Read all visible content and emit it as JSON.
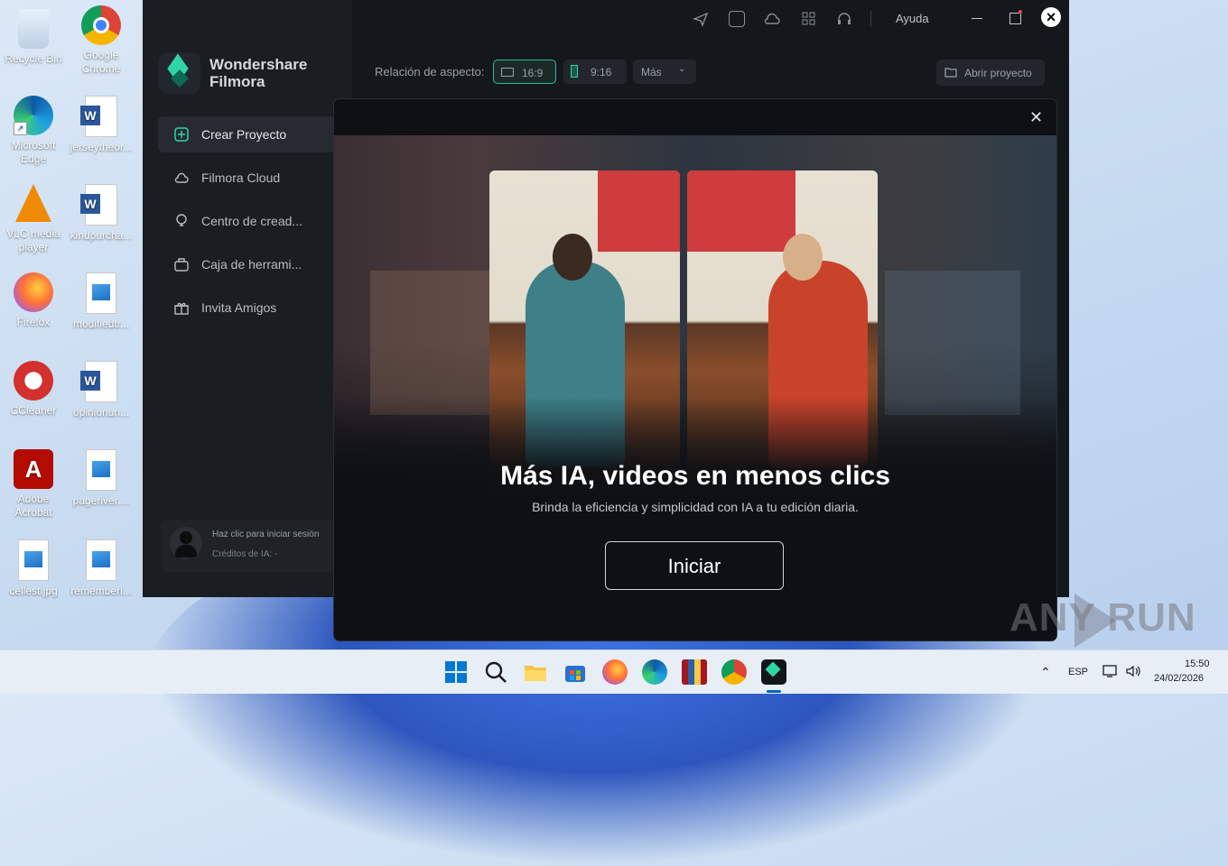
{
  "desktop": {
    "icons": [
      {
        "label": "Recycle Bin"
      },
      {
        "label": "Google Chrome"
      },
      {
        "label": "Microsoft Edge"
      },
      {
        "label": "jerseytheor..."
      },
      {
        "label": "VLC media player"
      },
      {
        "label": "kindpurcha..."
      },
      {
        "label": "Firefox"
      },
      {
        "label": "modifiedtr..."
      },
      {
        "label": "CCleaner"
      },
      {
        "label": "opinionun..."
      },
      {
        "label": "Adobe Acrobat"
      },
      {
        "label": "pageriver...."
      },
      {
        "label": "cellest.jpg"
      },
      {
        "label": "rememberi..."
      }
    ]
  },
  "filmora": {
    "brand_line1": "Wondershare",
    "brand_line2": "Filmora",
    "nav": [
      {
        "label": "Crear Proyecto",
        "icon": "plus-square-icon"
      },
      {
        "label": "Filmora Cloud",
        "icon": "cloud-icon"
      },
      {
        "label": "Centro de cread...",
        "icon": "bulb-icon"
      },
      {
        "label": "Caja de herrami...",
        "icon": "toolbox-icon"
      },
      {
        "label": "Invita Amigos",
        "icon": "gift-icon"
      }
    ],
    "login": {
      "line1": "Haz clic para iniciar sesión",
      "line2": "Créditos de IA: -"
    },
    "help": "Ayuda",
    "aspect_label": "Relación de aspecto:",
    "aspect_options": [
      "16:9",
      "9:16",
      "Más"
    ],
    "open_project": "Abrir proyecto"
  },
  "modal": {
    "title": "Más IA, videos en menos clics",
    "subtitle": "Brinda la eficiencia y simplicidad con IA a tu edición diaria.",
    "start_button": "Iniciar",
    "close": "✕"
  },
  "watermark": {
    "text": "ANY  RUN"
  },
  "taskbar": {
    "language": "ESP",
    "time": "15:50",
    "date": "24/02/2026"
  }
}
